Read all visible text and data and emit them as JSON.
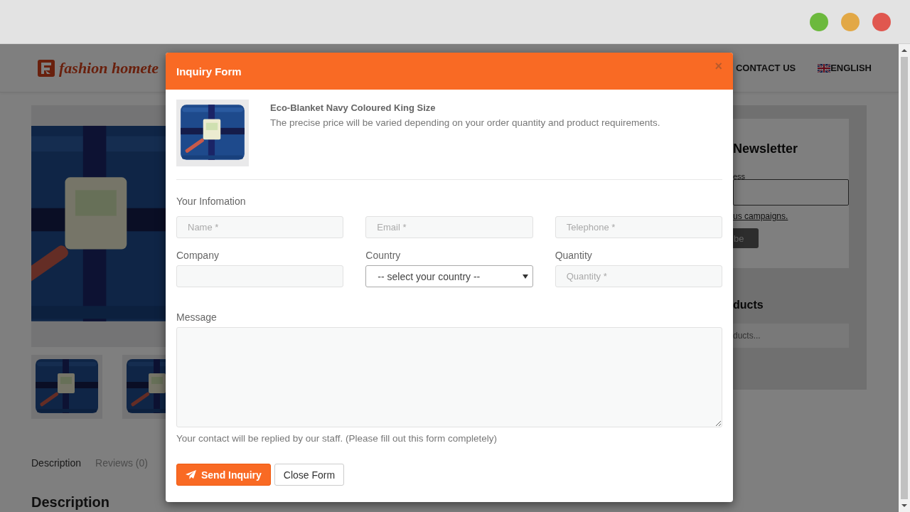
{
  "browser": {
    "controls": [
      {
        "color": "#6cb93d"
      },
      {
        "color": "#e2a846"
      },
      {
        "color": "#e0574f"
      }
    ]
  },
  "site_header": {
    "logo_text": "fashion homete",
    "nav": [
      {
        "kind": "link",
        "label": "CONTACT US"
      },
      {
        "kind": "language",
        "label": "ENGLISH"
      }
    ]
  },
  "product_tabs": [
    {
      "label": "Description",
      "selected": true
    },
    {
      "label": "Reviews (0)",
      "selected": false
    }
  ],
  "section_heading": "Description",
  "sidebar": {
    "newsletter_title": "Newsletter",
    "email_label": "ess",
    "consent_link": "us campaigns.",
    "subscribe_button": "be",
    "products_title": "ducts",
    "search_placeholder": "ducts..."
  },
  "modal": {
    "title": "Inquiry Form",
    "close": "×",
    "product": {
      "name": "Eco-Blanket Navy Coloured King Size",
      "note": "The precise price will be varied depending on your order quantity and product requirements."
    },
    "section_label": "Your Infomation",
    "fields": [
      {
        "kind": "input",
        "placeholder": "Name *"
      },
      {
        "kind": "input",
        "placeholder": "Email *"
      },
      {
        "kind": "input",
        "placeholder": "Telephone *"
      },
      {
        "kind": "input",
        "label": "Company"
      },
      {
        "kind": "select",
        "label": "Country",
        "value": "-- select your country --"
      },
      {
        "kind": "input",
        "label": "Quantity",
        "placeholder": "Quantity *"
      },
      {
        "kind": "textarea",
        "label": "Message"
      }
    ],
    "note": "Your contact will be replied by our staff. (Please fill out this form completely)",
    "buttons": [
      {
        "kind": "primary",
        "label": "Send Inquiry"
      },
      {
        "kind": "secondary",
        "label": "Close Form"
      }
    ]
  }
}
